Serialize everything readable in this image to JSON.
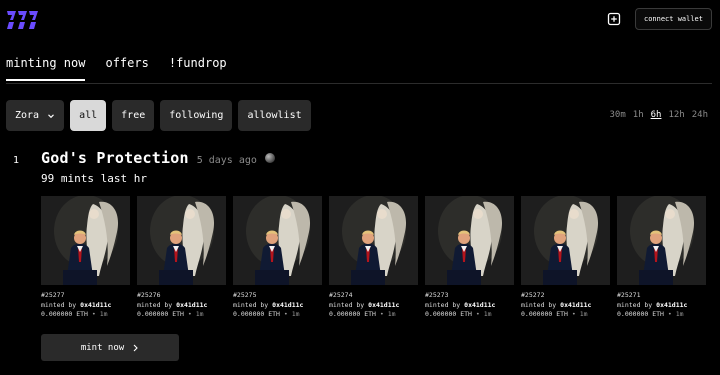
{
  "header": {
    "connect_wallet_label": "connect wallet"
  },
  "tabs": [
    {
      "label": "minting now",
      "active": true
    },
    {
      "label": "offers",
      "active": false
    },
    {
      "label": "!fundrop",
      "active": false
    }
  ],
  "filters": {
    "network": "Zora",
    "chips": [
      {
        "label": "all",
        "active": true
      },
      {
        "label": "free",
        "active": false
      },
      {
        "label": "following",
        "active": false
      },
      {
        "label": "allowlist",
        "active": false
      }
    ]
  },
  "time_ranges": [
    {
      "label": "30m",
      "selected": false
    },
    {
      "label": "1h",
      "selected": false
    },
    {
      "label": "6h",
      "selected": true
    },
    {
      "label": "12h",
      "selected": false
    },
    {
      "label": "24h",
      "selected": false
    }
  ],
  "collection": {
    "rank": "1",
    "title": "God's Protection",
    "ago": "5 days ago",
    "mints_line": "99 mints last hr",
    "mint_button_label": "mint now"
  },
  "tokens": [
    {
      "id": "#25277",
      "minted_by": "minted by",
      "minter": "0x41d11c",
      "price": "0.000000 ETH",
      "age": "1m"
    },
    {
      "id": "#25276",
      "minted_by": "minted by",
      "minter": "0x41d11c",
      "price": "0.000000 ETH",
      "age": "1m"
    },
    {
      "id": "#25275",
      "minted_by": "minted by",
      "minter": "0x41d11c",
      "price": "0.000000 ETH",
      "age": "1m"
    },
    {
      "id": "#25274",
      "minted_by": "minted by",
      "minter": "0x41d11c",
      "price": "0.000000 ETH",
      "age": "1m"
    },
    {
      "id": "#25273",
      "minted_by": "minted by",
      "minter": "0x41d11c",
      "price": "0.000000 ETH",
      "age": "1m"
    },
    {
      "id": "#25272",
      "minted_by": "minted by",
      "minter": "0x41d11c",
      "price": "0.000000 ETH",
      "age": "1m"
    },
    {
      "id": "#25271",
      "minted_by": "minted by",
      "minter": "0x41d11c",
      "price": "0.000000 ETH",
      "age": "1m"
    }
  ],
  "colors": {
    "accent": "#6a4cff",
    "chip_bg": "#2a2a2a",
    "chip_active_bg": "#d9d9d9"
  },
  "icons": {
    "logo": "mint-fun-logo",
    "add": "add-square-icon",
    "chain": "zora-orb-icon",
    "chevron": "chevron-down-icon",
    "arrow": "chevron-right-icon"
  }
}
